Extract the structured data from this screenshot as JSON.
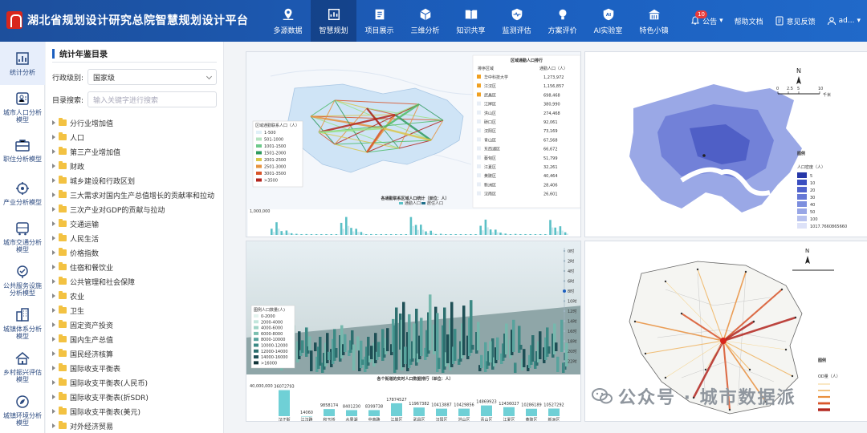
{
  "app": {
    "title": "湖北省规划设计研究总院智慧规划设计平台",
    "colors": {
      "header": "#1b5fbf",
      "accent": "#d8261c"
    }
  },
  "nav": [
    {
      "label": "多源数据",
      "icon": "map-pin-icon"
    },
    {
      "label": "智慧规划",
      "icon": "dashboard-icon",
      "active": true
    },
    {
      "label": "项目展示",
      "icon": "project-book-icon"
    },
    {
      "label": "三维分析",
      "icon": "cube-icon"
    },
    {
      "label": "知识共享",
      "icon": "open-book-icon"
    },
    {
      "label": "监测评估",
      "icon": "shield-pulse-icon"
    },
    {
      "label": "方案评价",
      "icon": "lightbulb-icon"
    },
    {
      "label": "AI实验室",
      "icon": "ai-shield-icon"
    },
    {
      "label": "特色小镇",
      "icon": "town-icon"
    }
  ],
  "toolbar": {
    "notice_label": "公告",
    "notice_count": "10",
    "help_label": "帮助文档",
    "feedback_label": "意见反馈",
    "user_label": "ad..."
  },
  "rail": [
    {
      "label": "统计分析",
      "icon": "stats-chart-icon",
      "active": true
    },
    {
      "label": "城市人口分析模型",
      "icon": "person-card-icon"
    },
    {
      "label": "职住分析模型",
      "icon": "briefcase-icon"
    },
    {
      "label": "产业分析模型",
      "icon": "industry-gear-icon"
    },
    {
      "label": "城市交通分析模型",
      "icon": "bus-icon"
    },
    {
      "label": "公共服务设施分析模型",
      "icon": "service-pin-icon"
    },
    {
      "label": "城镇体系分析模型",
      "icon": "buildings-icon"
    },
    {
      "label": "乡村振兴评估模型",
      "icon": "village-house-icon"
    },
    {
      "label": "城镇环境分析模型",
      "icon": "leaf-circle-icon"
    }
  ],
  "panel": {
    "title": "统计年鉴目录",
    "level_label": "行政级别:",
    "level_value": "国家级",
    "search_label": "目录搜索:",
    "search_placeholder": "输入关键字进行搜索",
    "tree": [
      "分行业增加值",
      "人口",
      "第三产业增加值",
      "财政",
      "城乡建设和行政区划",
      "三大需求对国内生产总值增长的贡献率和拉动",
      "三次产业对GDP的贡献与拉动",
      "交通运输",
      "人民生活",
      "价格指数",
      "住宿和餐饮业",
      "公共管理和社会保障",
      "农业",
      "卫生",
      "固定资产投资",
      "国内生产总值",
      "国民经济核算",
      "国际收支平衡表",
      "国际收支平衡表(人民币)",
      "国际收支平衡表(折SDR)",
      "国际收支平衡表(美元)",
      "对外经济贸易"
    ]
  },
  "maps": {
    "flow_legend_title": "区域通勤联系人口（人）",
    "flow_legend": [
      "1-500",
      "501-1000",
      "1001-1500",
      "1501-2000",
      "2001-2500",
      "2501-3000",
      "3001-3500",
      ">3500"
    ],
    "ranking_title": "区域通勤人口排行",
    "ranking_col1": "排序区域",
    "ranking_col2": "通勤人口（人）",
    "ranking_rows": [
      [
        "华中科技大学",
        "1,273,972"
      ],
      [
        "江汉区",
        "1,156,857"
      ],
      [
        "武昌区",
        "698,468"
      ],
      [
        "江岸区",
        "380,990"
      ],
      [
        "洪山区",
        "274,468"
      ],
      [
        "硚口区",
        "92,061"
      ],
      [
        "汉阳区",
        "73,169"
      ],
      [
        "青山区",
        "67,568"
      ],
      [
        "东西湖区",
        "66,672"
      ],
      [
        "蔡甸区",
        "51,799"
      ],
      [
        "江夏区",
        "32,261"
      ],
      [
        "黄陂区",
        "40,464"
      ],
      [
        "新洲区",
        "28,406"
      ],
      [
        "汉南区",
        "26,601"
      ]
    ],
    "bar_title": "各通勤联系区域人口统计（单位：人）",
    "bar_legend": [
      "通勤人口",
      "居住人口"
    ],
    "bar_ymax_label": "1,000,000",
    "density_legend_title": "图例",
    "density_legend_sub": "人口密度（人）",
    "density_legend": [
      "5",
      "10",
      "20",
      "30",
      "40",
      "50",
      "100",
      "1017.7660865660"
    ],
    "density_scale": [
      "0",
      "2.5",
      "5",
      "10"
    ],
    "density_scale_unit": "千米",
    "city3d_legend_title": "图例人口数量(人)",
    "city3d_legend": [
      "0-2000",
      "2000-4000",
      "4000-6000",
      "6000-8000",
      "8000-10000",
      "10000-12000",
      "12000-14000",
      "14000-16000",
      ">16000"
    ],
    "city3d_time_labels": [
      "0时",
      "2时",
      "4时",
      "6时",
      "8时",
      "10时",
      "12时",
      "14时",
      "16时",
      "18时",
      "20时",
      "22时"
    ],
    "city3d_bar_title": "各个街道的实时人口数据排行（单位：人）",
    "city3d_bar_ymax": "40,000,000",
    "city3d_bar_values": [
      "36072793",
      "14060",
      "9858174",
      "8401230",
      "8399738",
      "17874527",
      "11967382",
      "10413887",
      "10429856",
      "14869923",
      "12436027",
      "10286189",
      "10527292"
    ],
    "city3d_bar_labels": [
      "汉正街",
      "江汉路",
      "积玉桥",
      "水果湖",
      "中南路",
      "江岸区",
      "武昌区",
      "汉阳区",
      "洪山区",
      "青山区",
      "江夏区",
      "黄陂区",
      "新洲区"
    ],
    "od_legend_title": "图例",
    "od_legend_sub": "OD量（人）"
  },
  "watermark": "公众号 · 城市数据派"
}
